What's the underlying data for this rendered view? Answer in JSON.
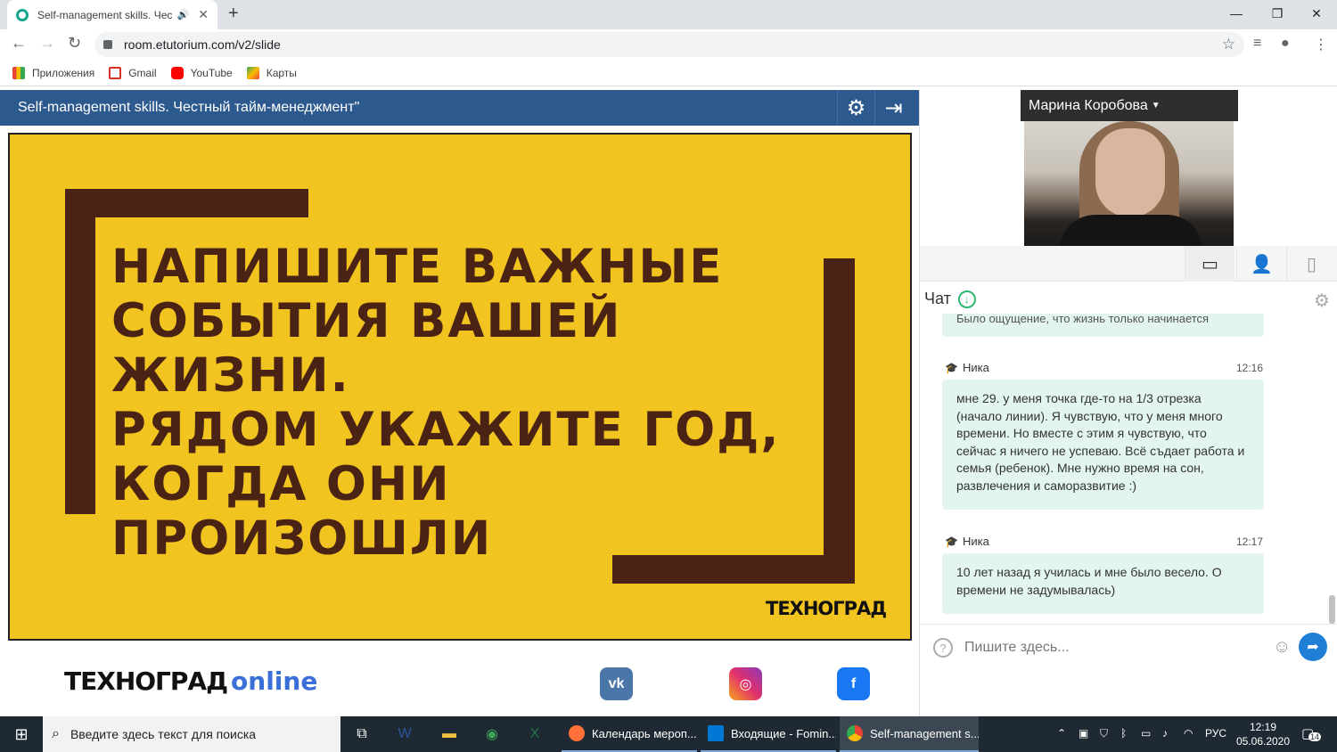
{
  "browser": {
    "tab_title": "Self-management skills. Чест",
    "address": "room.etutorium.com/v2/slide",
    "bookmarks": [
      "Приложения",
      "Gmail",
      "YouTube",
      "Карты"
    ]
  },
  "slide_header": {
    "title": "Self-management skills. Честный тайм-менеджмент\""
  },
  "slide": {
    "lines": [
      "НАПИШИТЕ ВАЖНЫЕ",
      "СОБЫТИЯ ВАШЕЙ",
      "ЖИЗНИ.",
      "РЯДОМ УКАЖИТЕ ГОД,",
      "КОГДА ОНИ",
      "ПРОИЗОШЛИ"
    ],
    "logo": "ТЕХНОГРАД",
    "bg_color": "#f2c41f",
    "text_color": "#4a2314"
  },
  "footer": {
    "logo": "ТЕХНОГРАД",
    "logo_suffix": "online"
  },
  "presenter": {
    "name": "Марина Коробова"
  },
  "chat": {
    "title": "Чат",
    "prev_fragment": "Было ощущение, что жизнь только начинается",
    "messages": [
      {
        "author": "Ника",
        "time": "12:16",
        "text": "мне 29. у меня точка где-то на 1/3 отрезка (начало линии). Я чувствую, что у меня много времени. Но вместе с этим я чувствую, что сейчас я ничего не успеваю. Всё съдает работа и семья (ребенок). Мне нужно время на сон, развлечения и саморазвитие :)"
      },
      {
        "author": "Ника",
        "time": "12:17",
        "text": "10 лет назад я училась и мне было весело. О времени не задумывалась)"
      }
    ],
    "input_placeholder": "Пишите здесь..."
  },
  "taskbar": {
    "search_placeholder": "Введите здесь текст для поиска",
    "apps": [
      "Календарь мероп...",
      "Входящие - Fomin...",
      "Self-management s..."
    ],
    "lang": "РУС",
    "time": "12:19",
    "date": "05.06.2020",
    "notifications": "14"
  }
}
